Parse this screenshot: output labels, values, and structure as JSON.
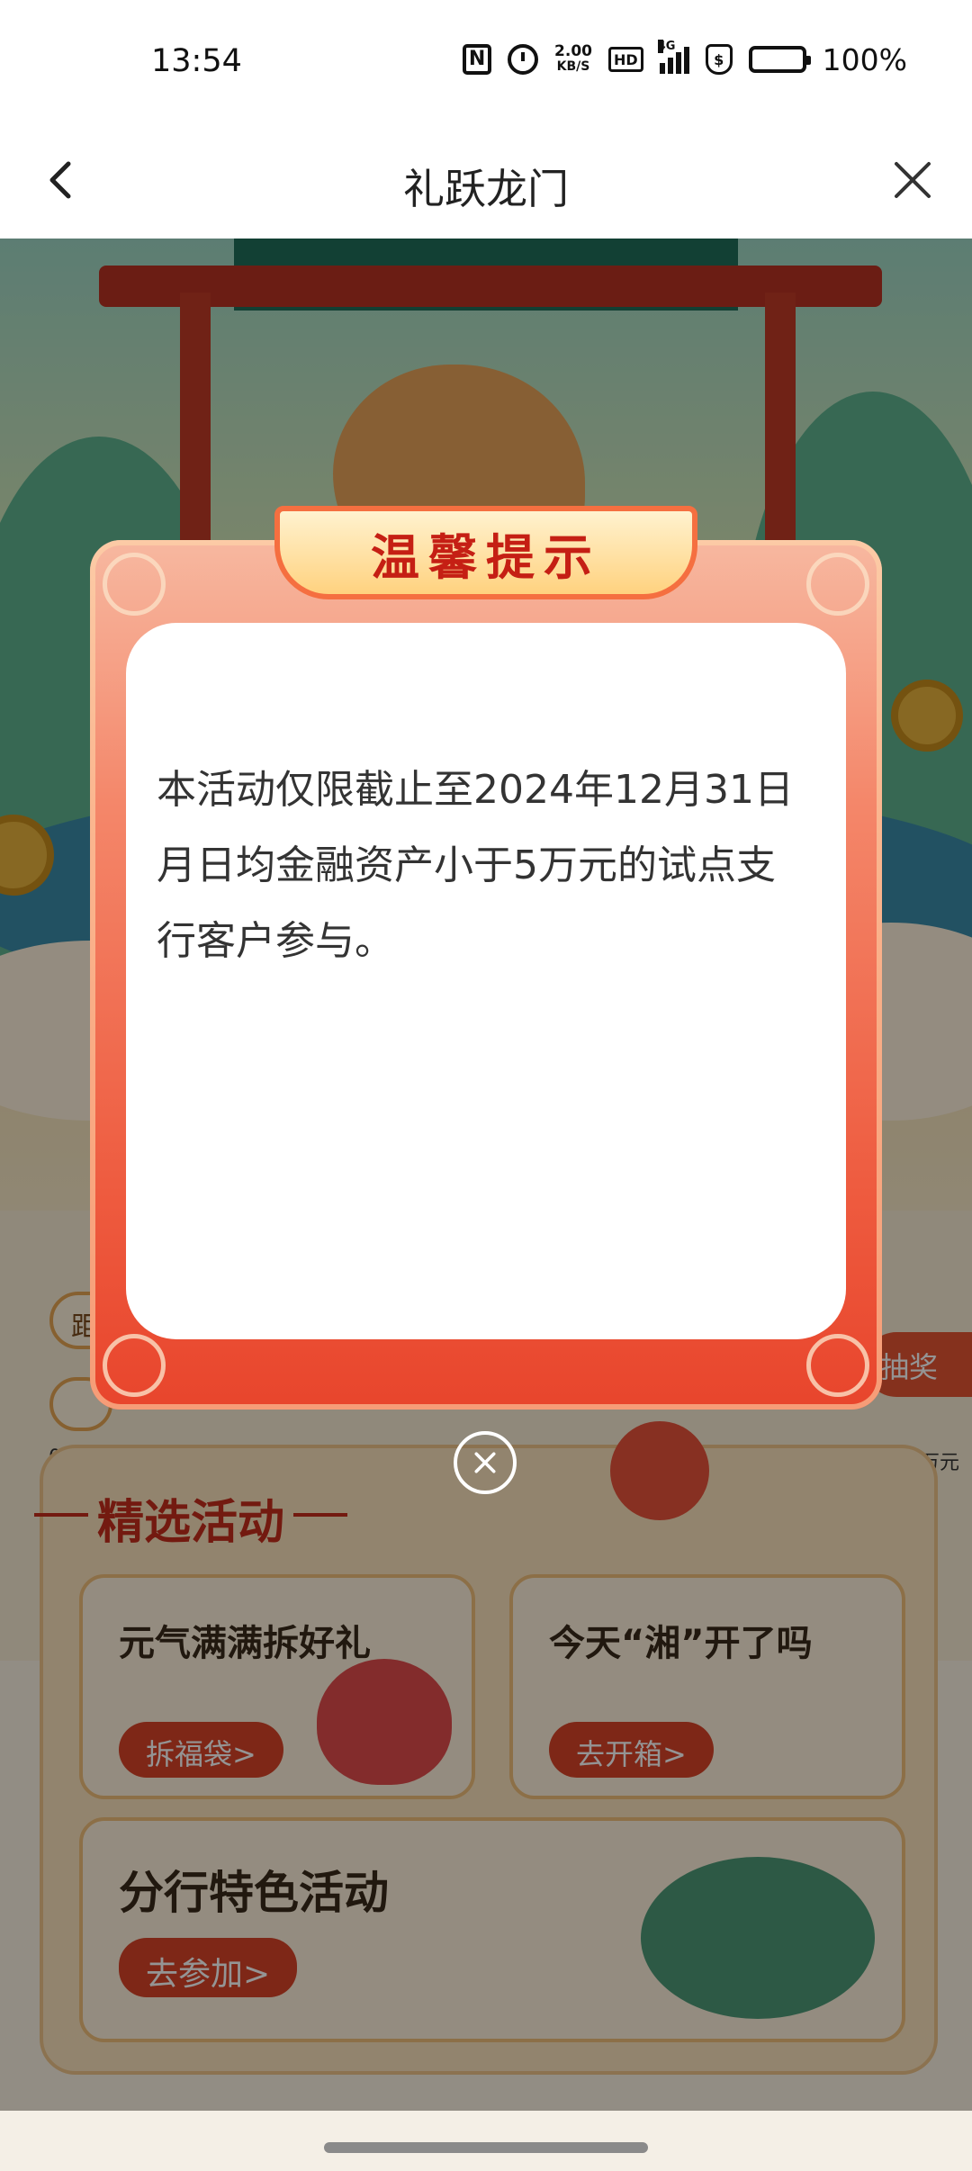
{
  "status_bar": {
    "time": "13:54",
    "net_speed_value": "2.00",
    "net_speed_unit": "KB/S",
    "hd_label": "HD",
    "network_label": "4G",
    "battery_percent": "100%",
    "nfc_label": "N",
    "shield_label": "$"
  },
  "nav": {
    "title": "礼跃龙门",
    "back_icon": "chevron-left-icon",
    "close_icon": "close-icon"
  },
  "background": {
    "progress": {
      "pill_text": "距",
      "start_label": "0",
      "end_label": "提升5万元",
      "draw_badge": "抽奖"
    },
    "activities": {
      "title": "精选活动",
      "cards": [
        {
          "title": "元气满满拆好礼",
          "button": "拆福袋>"
        },
        {
          "title": "今天“湘”开了吗",
          "button": "去开箱>"
        },
        {
          "title": "分行特色活动",
          "button": "去参加>"
        }
      ]
    }
  },
  "modal": {
    "title": "温馨提示",
    "message": "本活动仅限截止至2024年12月31日月日均金融资产小于5万元的试点支行客户参与。",
    "close_icon": "close-circle-icon"
  },
  "colors": {
    "modal_red": "#ee5b3f",
    "title_red": "#c51f14",
    "button_red": "#d94428"
  }
}
